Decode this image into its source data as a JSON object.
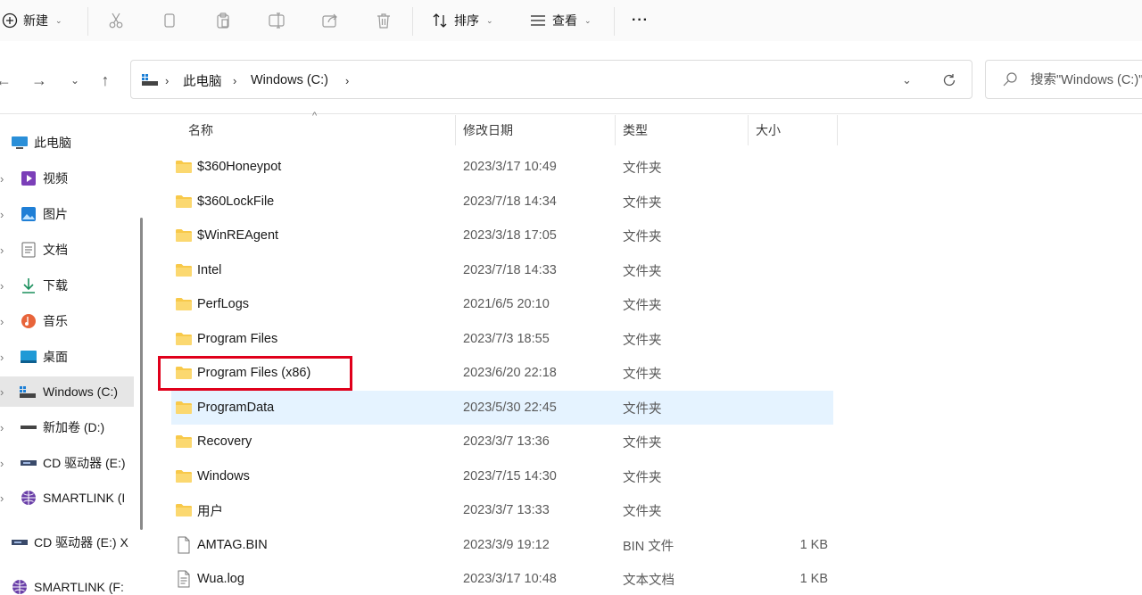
{
  "toolbar": {
    "new_label": "新建",
    "sort_label": "排序",
    "view_label": "查看",
    "more_label": "···"
  },
  "address": {
    "crumbs": [
      "此电脑",
      "Windows (C:)"
    ],
    "search_placeholder": "搜索\"Windows (C:)\""
  },
  "sidebar": {
    "items": [
      {
        "label": "此电脑",
        "icon": "computer-icon"
      },
      {
        "label": "视频",
        "icon": "video-icon"
      },
      {
        "label": "图片",
        "icon": "pictures-icon"
      },
      {
        "label": "文档",
        "icon": "documents-icon"
      },
      {
        "label": "下载",
        "icon": "download-icon"
      },
      {
        "label": "音乐",
        "icon": "music-icon"
      },
      {
        "label": "桌面",
        "icon": "desktop-icon"
      },
      {
        "label": "Windows (C:)",
        "icon": "drive-icon"
      },
      {
        "label": "新加卷 (D:)",
        "icon": "drive-icon"
      },
      {
        "label": "CD 驱动器 (E:)",
        "icon": "cd-drive-icon"
      },
      {
        "label": "SMARTLINK (I",
        "icon": "globe-icon"
      },
      {
        "label": "CD 驱动器 (E:) X",
        "icon": "cd-drive-icon"
      },
      {
        "label": "SMARTLINK (F:",
        "icon": "globe-icon"
      }
    ]
  },
  "columns": {
    "name": "名称",
    "date": "修改日期",
    "type": "类型",
    "size": "大小"
  },
  "files": [
    {
      "name": "$360Honeypot",
      "date": "2023/3/17 10:49",
      "type": "文件夹",
      "size": "",
      "kind": "folder"
    },
    {
      "name": "$360LockFile",
      "date": "2023/7/18 14:34",
      "type": "文件夹",
      "size": "",
      "kind": "folder"
    },
    {
      "name": "$WinREAgent",
      "date": "2023/3/18 17:05",
      "type": "文件夹",
      "size": "",
      "kind": "folder"
    },
    {
      "name": "Intel",
      "date": "2023/7/18 14:33",
      "type": "文件夹",
      "size": "",
      "kind": "folder"
    },
    {
      "name": "PerfLogs",
      "date": "2021/6/5 20:10",
      "type": "文件夹",
      "size": "",
      "kind": "folder"
    },
    {
      "name": "Program Files",
      "date": "2023/7/3 18:55",
      "type": "文件夹",
      "size": "",
      "kind": "folder"
    },
    {
      "name": "Program Files (x86)",
      "date": "2023/6/20 22:18",
      "type": "文件夹",
      "size": "",
      "kind": "folder"
    },
    {
      "name": "ProgramData",
      "date": "2023/5/30 22:45",
      "type": "文件夹",
      "size": "",
      "kind": "folder"
    },
    {
      "name": "Recovery",
      "date": "2023/3/7 13:36",
      "type": "文件夹",
      "size": "",
      "kind": "folder"
    },
    {
      "name": "Windows",
      "date": "2023/7/15 14:30",
      "type": "文件夹",
      "size": "",
      "kind": "folder"
    },
    {
      "name": "用户",
      "date": "2023/3/7 13:33",
      "type": "文件夹",
      "size": "",
      "kind": "folder"
    },
    {
      "name": "AMTAG.BIN",
      "date": "2023/3/9 19:12",
      "type": "BIN 文件",
      "size": "1 KB",
      "kind": "file"
    },
    {
      "name": "Wua.log",
      "date": "2023/3/17 10:48",
      "type": "文本文档",
      "size": "1 KB",
      "kind": "text"
    }
  ],
  "colors": {
    "hover_row": "#e5f3ff",
    "highlight_box": "#e0001b",
    "folder": "#f8c94a"
  }
}
